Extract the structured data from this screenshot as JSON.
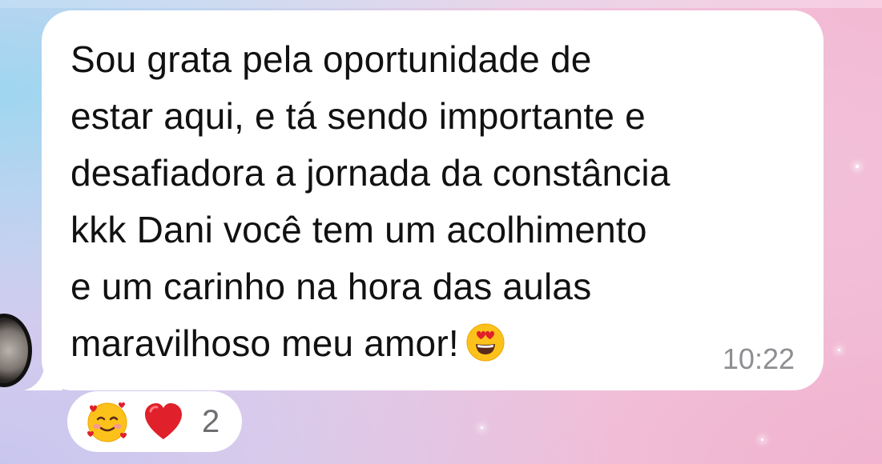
{
  "message": {
    "lines": [
      "Sou grata pela oportunidade de",
      "estar aqui, e tá sendo importante e",
      "desafiadora a jornada da constância",
      "kkk Dani você tem um acolhimento",
      "e um carinho na hora das aulas",
      "maravilhoso meu amor!"
    ],
    "emoji": "heart-eyes-emoji-icon",
    "time": "10:22"
  },
  "reactions": {
    "icons": [
      "smiling-face-with-hearts-icon",
      "red-heart-icon"
    ],
    "count": "2"
  },
  "colors": {
    "bubble": "#ffffff",
    "text": "#111111",
    "time": "#8e8e93",
    "heart": "#e0202a"
  }
}
